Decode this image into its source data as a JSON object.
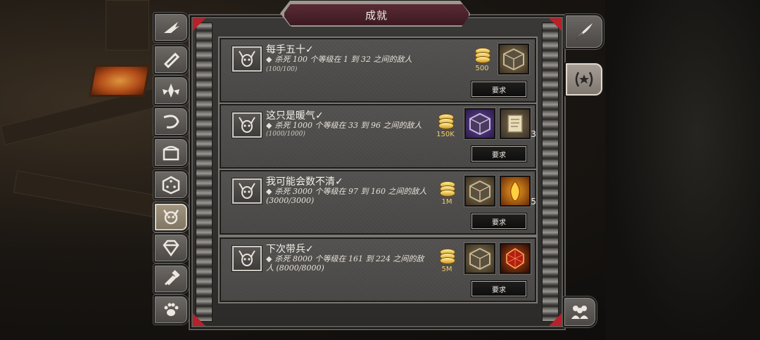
{
  "window": {
    "title": "成就"
  },
  "left_tabs": [
    {
      "name": "wings-icon",
      "active": false
    },
    {
      "name": "scroll-icon",
      "active": false
    },
    {
      "name": "winged-emblem-icon",
      "active": false
    },
    {
      "name": "horn-icon",
      "active": false
    },
    {
      "name": "chest-icon",
      "active": false
    },
    {
      "name": "dice-icon",
      "active": false
    },
    {
      "name": "demon-skull-icon",
      "active": true
    },
    {
      "name": "gem-icon",
      "active": false
    },
    {
      "name": "hammers-icon",
      "active": false
    },
    {
      "name": "paw-icon",
      "active": false
    }
  ],
  "achievements": [
    {
      "title": "每手五十✓",
      "desc": "杀死 100 个等级在 1 到 32 之间的敌人",
      "progress": "(100/100)",
      "gold": "500",
      "rewards": [
        {
          "icon": "cube-icon",
          "qty": ""
        }
      ],
      "req_label": "要求"
    },
    {
      "title": "这只是暖气✓",
      "desc": "杀死 1000 个等级在 33 到 96 之间的敌人",
      "progress": "(1000/1000)",
      "gold": "150K",
      "rewards": [
        {
          "icon": "purple-cube-icon",
          "qty": ""
        },
        {
          "icon": "scroll-item-icon",
          "qty": "3"
        }
      ],
      "req_label": "要求"
    },
    {
      "title": "我可能会数不清✓",
      "desc": "杀死 3000 个等级在 97 到 160 之间的敌人 (3000/3000)",
      "progress": "",
      "gold": "1M",
      "rewards": [
        {
          "icon": "cube-icon",
          "qty": ""
        },
        {
          "icon": "fire-crystal-icon",
          "qty": "5"
        }
      ],
      "req_label": "要求"
    },
    {
      "title": "下次带兵✓",
      "desc": "杀死 8000 个等级在 161 到 224 之间的敌人 (8000/8000)",
      "progress": "",
      "gold": "5M",
      "rewards": [
        {
          "icon": "cube-icon",
          "qty": ""
        },
        {
          "icon": "red-gem-icon",
          "qty": ""
        }
      ],
      "req_label": "要求"
    }
  ],
  "right_buttons": [
    {
      "name": "quill-icon",
      "active": false
    },
    {
      "name": "laurel-star-icon",
      "active": true
    },
    {
      "name": "group-icon",
      "active": false
    }
  ],
  "colors": {
    "accent_red": "#b8202a",
    "title_bar": "#5a2a34",
    "gold_text": "#f0d070"
  }
}
